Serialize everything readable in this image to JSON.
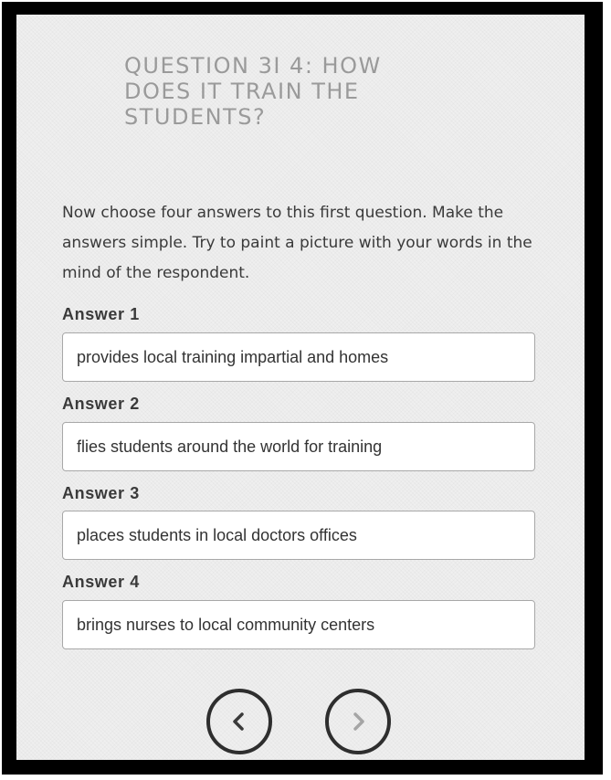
{
  "question": {
    "title": "QUESTION 3I 4: HOW DOES IT TRAIN THE STUDENTS?"
  },
  "instructions": "Now choose four answers to this first question. Make the answers simple. Try to paint a picture with your words in the mind of the respondent.",
  "answers": [
    {
      "label": "Answer 1",
      "value": "provides local training impartial and homes"
    },
    {
      "label": "Answer 2",
      "value": "flies students around the world for training"
    },
    {
      "label": "Answer 3",
      "value": "places students in local doctors offices"
    },
    {
      "label": "Answer 4",
      "value": "brings nurses to local community centers"
    }
  ],
  "navigation": {
    "previous_icon": "chevron-left-icon",
    "next_icon": "chevron-right-icon"
  },
  "colors": {
    "panel_background": "#efefef",
    "title_text": "#9a9a9a",
    "body_text": "#3a3a3a",
    "input_border": "#a8a8a8",
    "previous_arrow": "#3a3a3a",
    "next_arrow": "#a5a5a5"
  }
}
